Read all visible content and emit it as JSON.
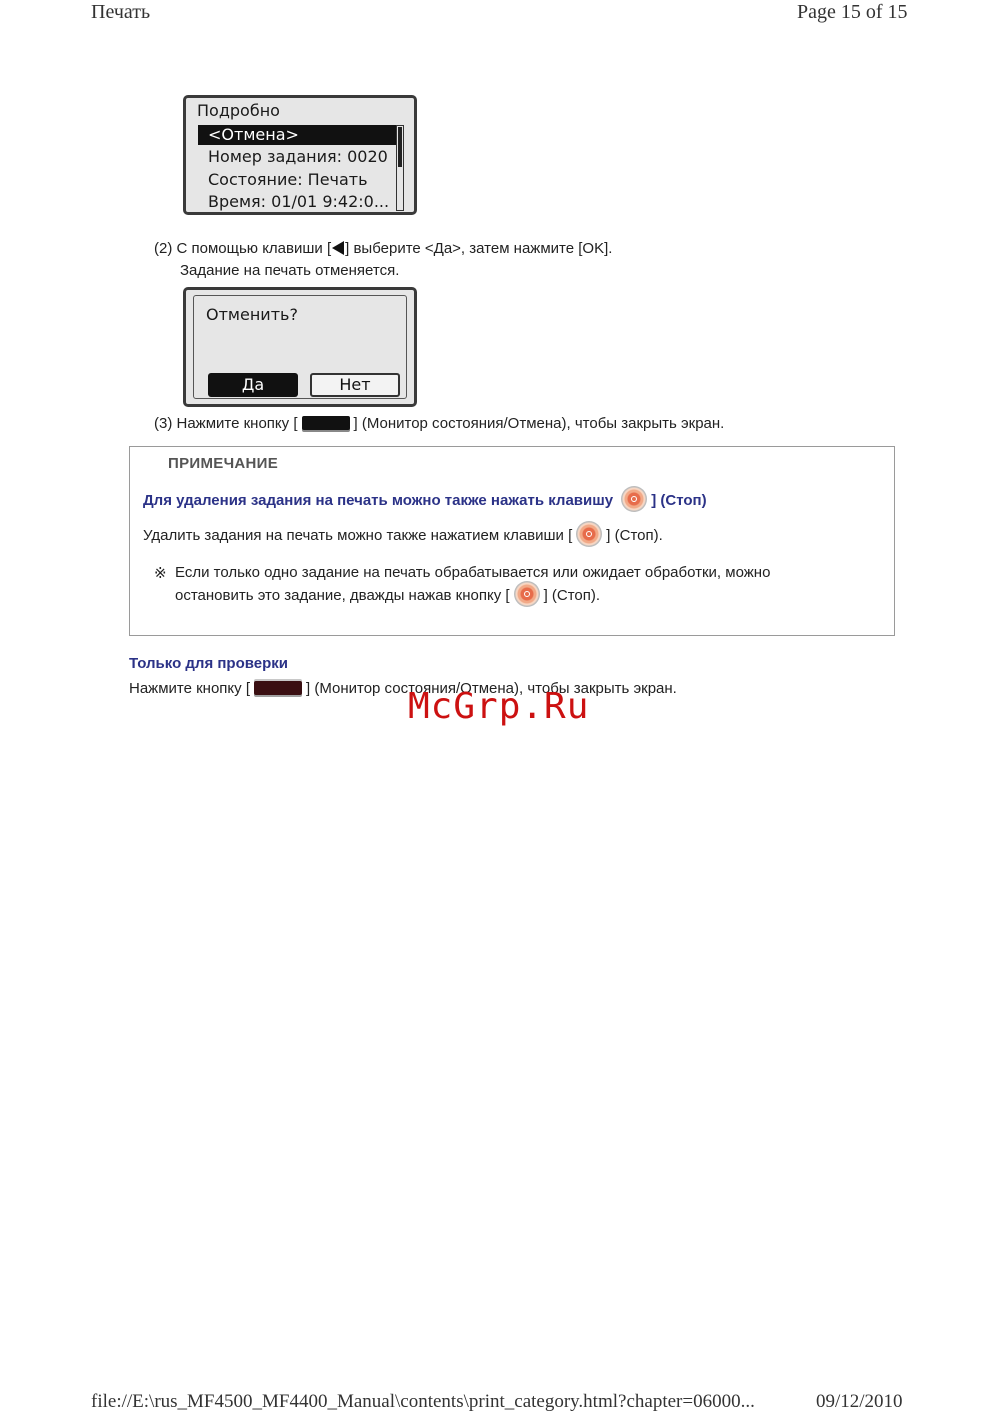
{
  "header": {
    "title": "Печать",
    "page": "Page 15 of 15"
  },
  "lcd1": {
    "title": "Подробно",
    "rows": [
      "<Отмена>",
      "Номер задания: 0020",
      "Состояние: Печать",
      "Время: 01/01 9:42:0..."
    ]
  },
  "step2": {
    "line1_a": "(2) С помощью клавиши [",
    "line1_b": "] выберите <Да>, затем нажмите [OK].",
    "line2": "Задание на печать отменяется."
  },
  "lcd2": {
    "question": "Отменить?",
    "yes": "Да",
    "no": "Нет"
  },
  "step3": {
    "a": "(3) Нажмите кнопку [",
    "b": "] (Монитор состояния/Отмена), чтобы закрыть экран."
  },
  "note": {
    "heading": "ПРИМЕЧАНИЕ",
    "title_a": "Для удаления задания на печать можно также нажать клавишу",
    "title_b": "] (Стоп)",
    "line1_a": "Удалить задания на печать можно также нажатием клавиши [",
    "line1_b": "] (Стоп).",
    "bullet_mark": "※",
    "bullet_line1": "Если только одно задание на печать обрабатывается или ожидает обработки, можно",
    "bullet_line2_a": "остановить это задание, дважды нажав кнопку [",
    "bullet_line2_b": "] (Стоп)."
  },
  "check": {
    "title": "Только для проверки",
    "a": "Нажмите кнопку [",
    "b": "] (Монитор состояния/Отмена), чтобы закрыть экран."
  },
  "watermark": "McGrp.Ru",
  "footer": {
    "path": "file://E:\\rus_MF4500_MF4400_Manual\\contents\\print_category.html?chapter=06000...",
    "date": "09/12/2010"
  }
}
